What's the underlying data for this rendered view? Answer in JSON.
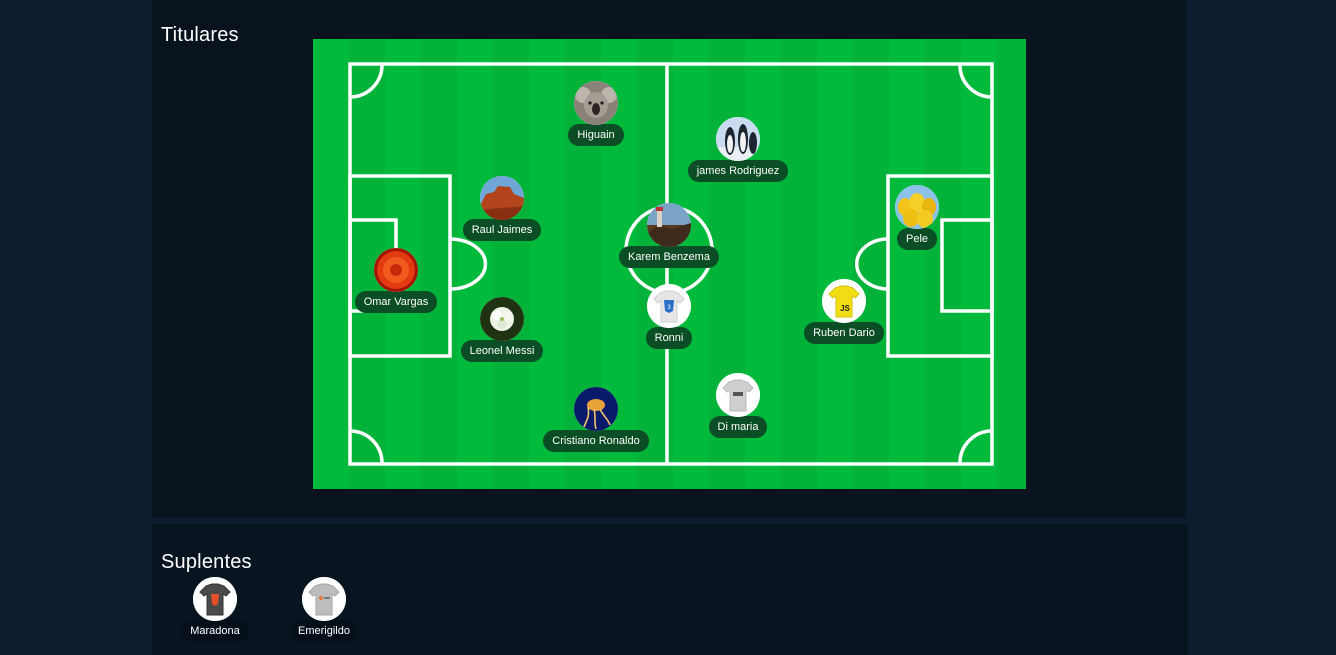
{
  "starters": {
    "title": "Titulares",
    "players": [
      {
        "name": "Higuain",
        "avatar": "koala-avatar-icon"
      },
      {
        "name": "james Rodriguez",
        "avatar": "penguins-avatar-icon"
      },
      {
        "name": "Raul Jaimes",
        "avatar": "desert-avatar-icon"
      },
      {
        "name": "Karem Benzema",
        "avatar": "lighthouse-avatar-icon"
      },
      {
        "name": "Pele",
        "avatar": "tulips-avatar-icon"
      },
      {
        "name": "Omar Vargas",
        "avatar": "chrysanthemum-avatar-icon"
      },
      {
        "name": "Ronni",
        "avatar": "css3-shirt-avatar-icon"
      },
      {
        "name": "Ruben Dario",
        "avatar": "js-shirt-avatar-icon"
      },
      {
        "name": "Leonel Messi",
        "avatar": "hydrangea-avatar-icon"
      },
      {
        "name": "Cristiano Ronaldo",
        "avatar": "jellyfish-avatar-icon"
      },
      {
        "name": "Di maria",
        "avatar": "grey-shirt-avatar-icon"
      }
    ]
  },
  "substitutes": {
    "title": "Suplentes",
    "players": [
      {
        "name": "Maradona",
        "avatar": "html5-shirt-avatar-icon"
      },
      {
        "name": "Emerigildo",
        "avatar": "grey-shirt-avatar-icon"
      }
    ]
  },
  "colors": {
    "page_background": "#0c1d2f",
    "panel_background": "#09131d",
    "pitch_green": "#00bb3b",
    "pitch_green_stripe": "#03b239",
    "tag_background": "#0b4d24"
  }
}
